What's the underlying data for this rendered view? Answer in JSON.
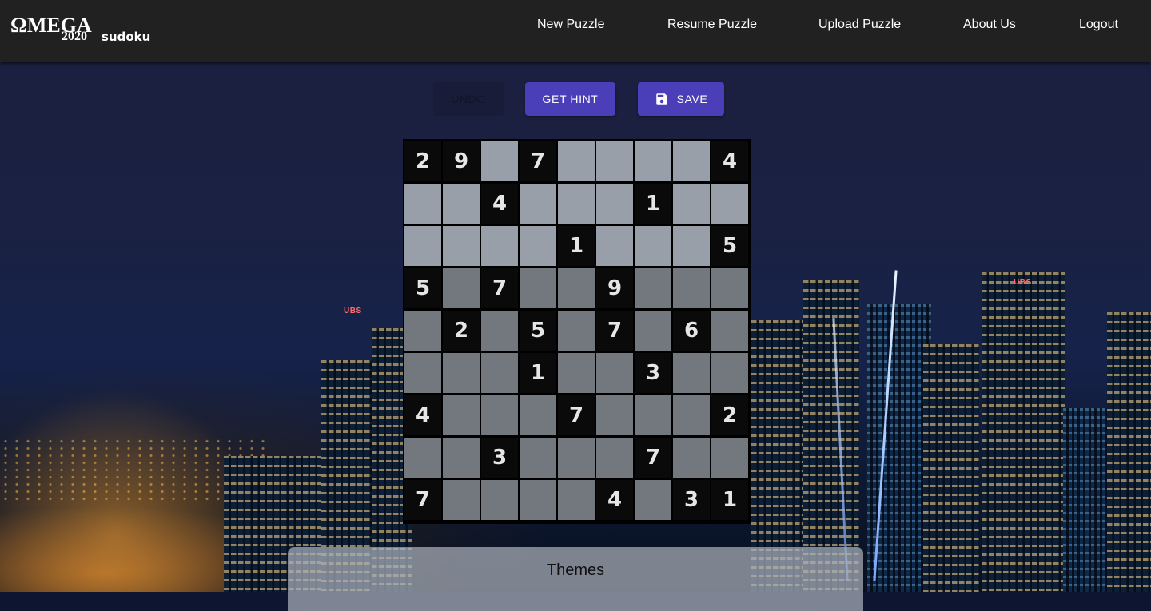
{
  "logo": {
    "omega": "ΩMEGA",
    "year": "2020",
    "sudoku": "sudoku"
  },
  "nav": [
    "New Puzzle",
    "Resume Puzzle",
    "Upload Puzzle",
    "About Us",
    "Logout"
  ],
  "toolbar": {
    "undo_label": "UNDO",
    "hint_label": "GET HINT",
    "save_label": "SAVE"
  },
  "board": [
    [
      "2",
      "9",
      "",
      "7",
      "",
      "",
      "",
      "",
      "4"
    ],
    [
      "",
      "",
      "4",
      "",
      "",
      "",
      "1",
      "",
      ""
    ],
    [
      "",
      "",
      "",
      "",
      "1",
      "",
      "",
      "",
      "5"
    ],
    [
      "5",
      "",
      "7",
      "",
      "",
      "9",
      "",
      "",
      ""
    ],
    [
      "",
      "2",
      "",
      "5",
      "",
      "7",
      "",
      "6",
      ""
    ],
    [
      "",
      "",
      "",
      "1",
      "",
      "",
      "3",
      "",
      ""
    ],
    [
      "4",
      "",
      "",
      "",
      "7",
      "",
      "",
      "",
      "2"
    ],
    [
      "",
      "",
      "3",
      "",
      "",
      "",
      "7",
      "",
      ""
    ],
    [
      "7",
      "",
      "",
      "",
      "",
      "4",
      "",
      "3",
      "1"
    ]
  ],
  "themes": {
    "title": "Themes"
  },
  "colors": {
    "accent": "#4a3fb8",
    "header": "#212121",
    "given_cell": "#0a0a0a",
    "empty_cell": "#bac2cd"
  },
  "icons": {
    "save": "floppy-disk-icon"
  }
}
